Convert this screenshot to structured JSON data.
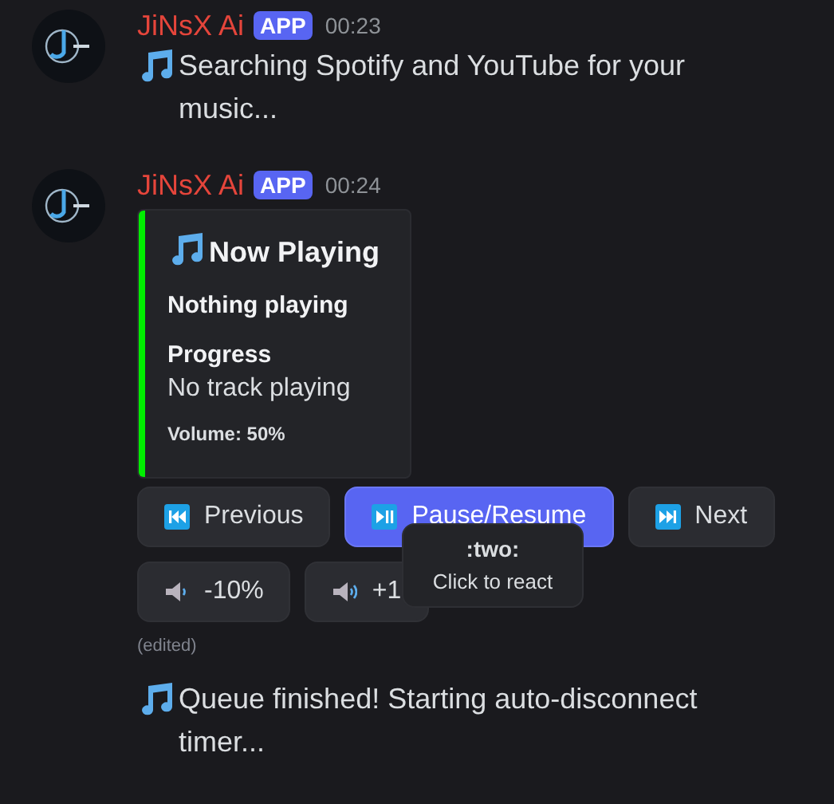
{
  "messages": [
    {
      "author": "JiNsX Ai",
      "badge": "APP",
      "time": "00:23",
      "text": "Searching Spotify and YouTube for your music..."
    },
    {
      "author": "JiNsX Ai",
      "badge": "APP",
      "time": "00:24",
      "embed": {
        "color": "#00ee00",
        "title": "Now Playing",
        "subtitle": "Nothing playing",
        "field_name": "Progress",
        "field_value": "No track playing",
        "footer": "Volume: 50%"
      },
      "button_rows": [
        [
          {
            "label": "Previous",
            "kind": "previous"
          },
          {
            "label": "Pause/Resume",
            "kind": "playpause"
          },
          {
            "label": "Next",
            "kind": "next"
          }
        ],
        [
          {
            "label": "-10%",
            "kind": "volumedown"
          },
          {
            "label": "+1",
            "kind": "volumeup"
          }
        ]
      ],
      "edited": "(edited)",
      "tooltip": {
        "title": ":two:",
        "hint": "Click to react"
      }
    },
    {
      "text": "Queue finished! Starting auto-disconnect timer..."
    }
  ]
}
